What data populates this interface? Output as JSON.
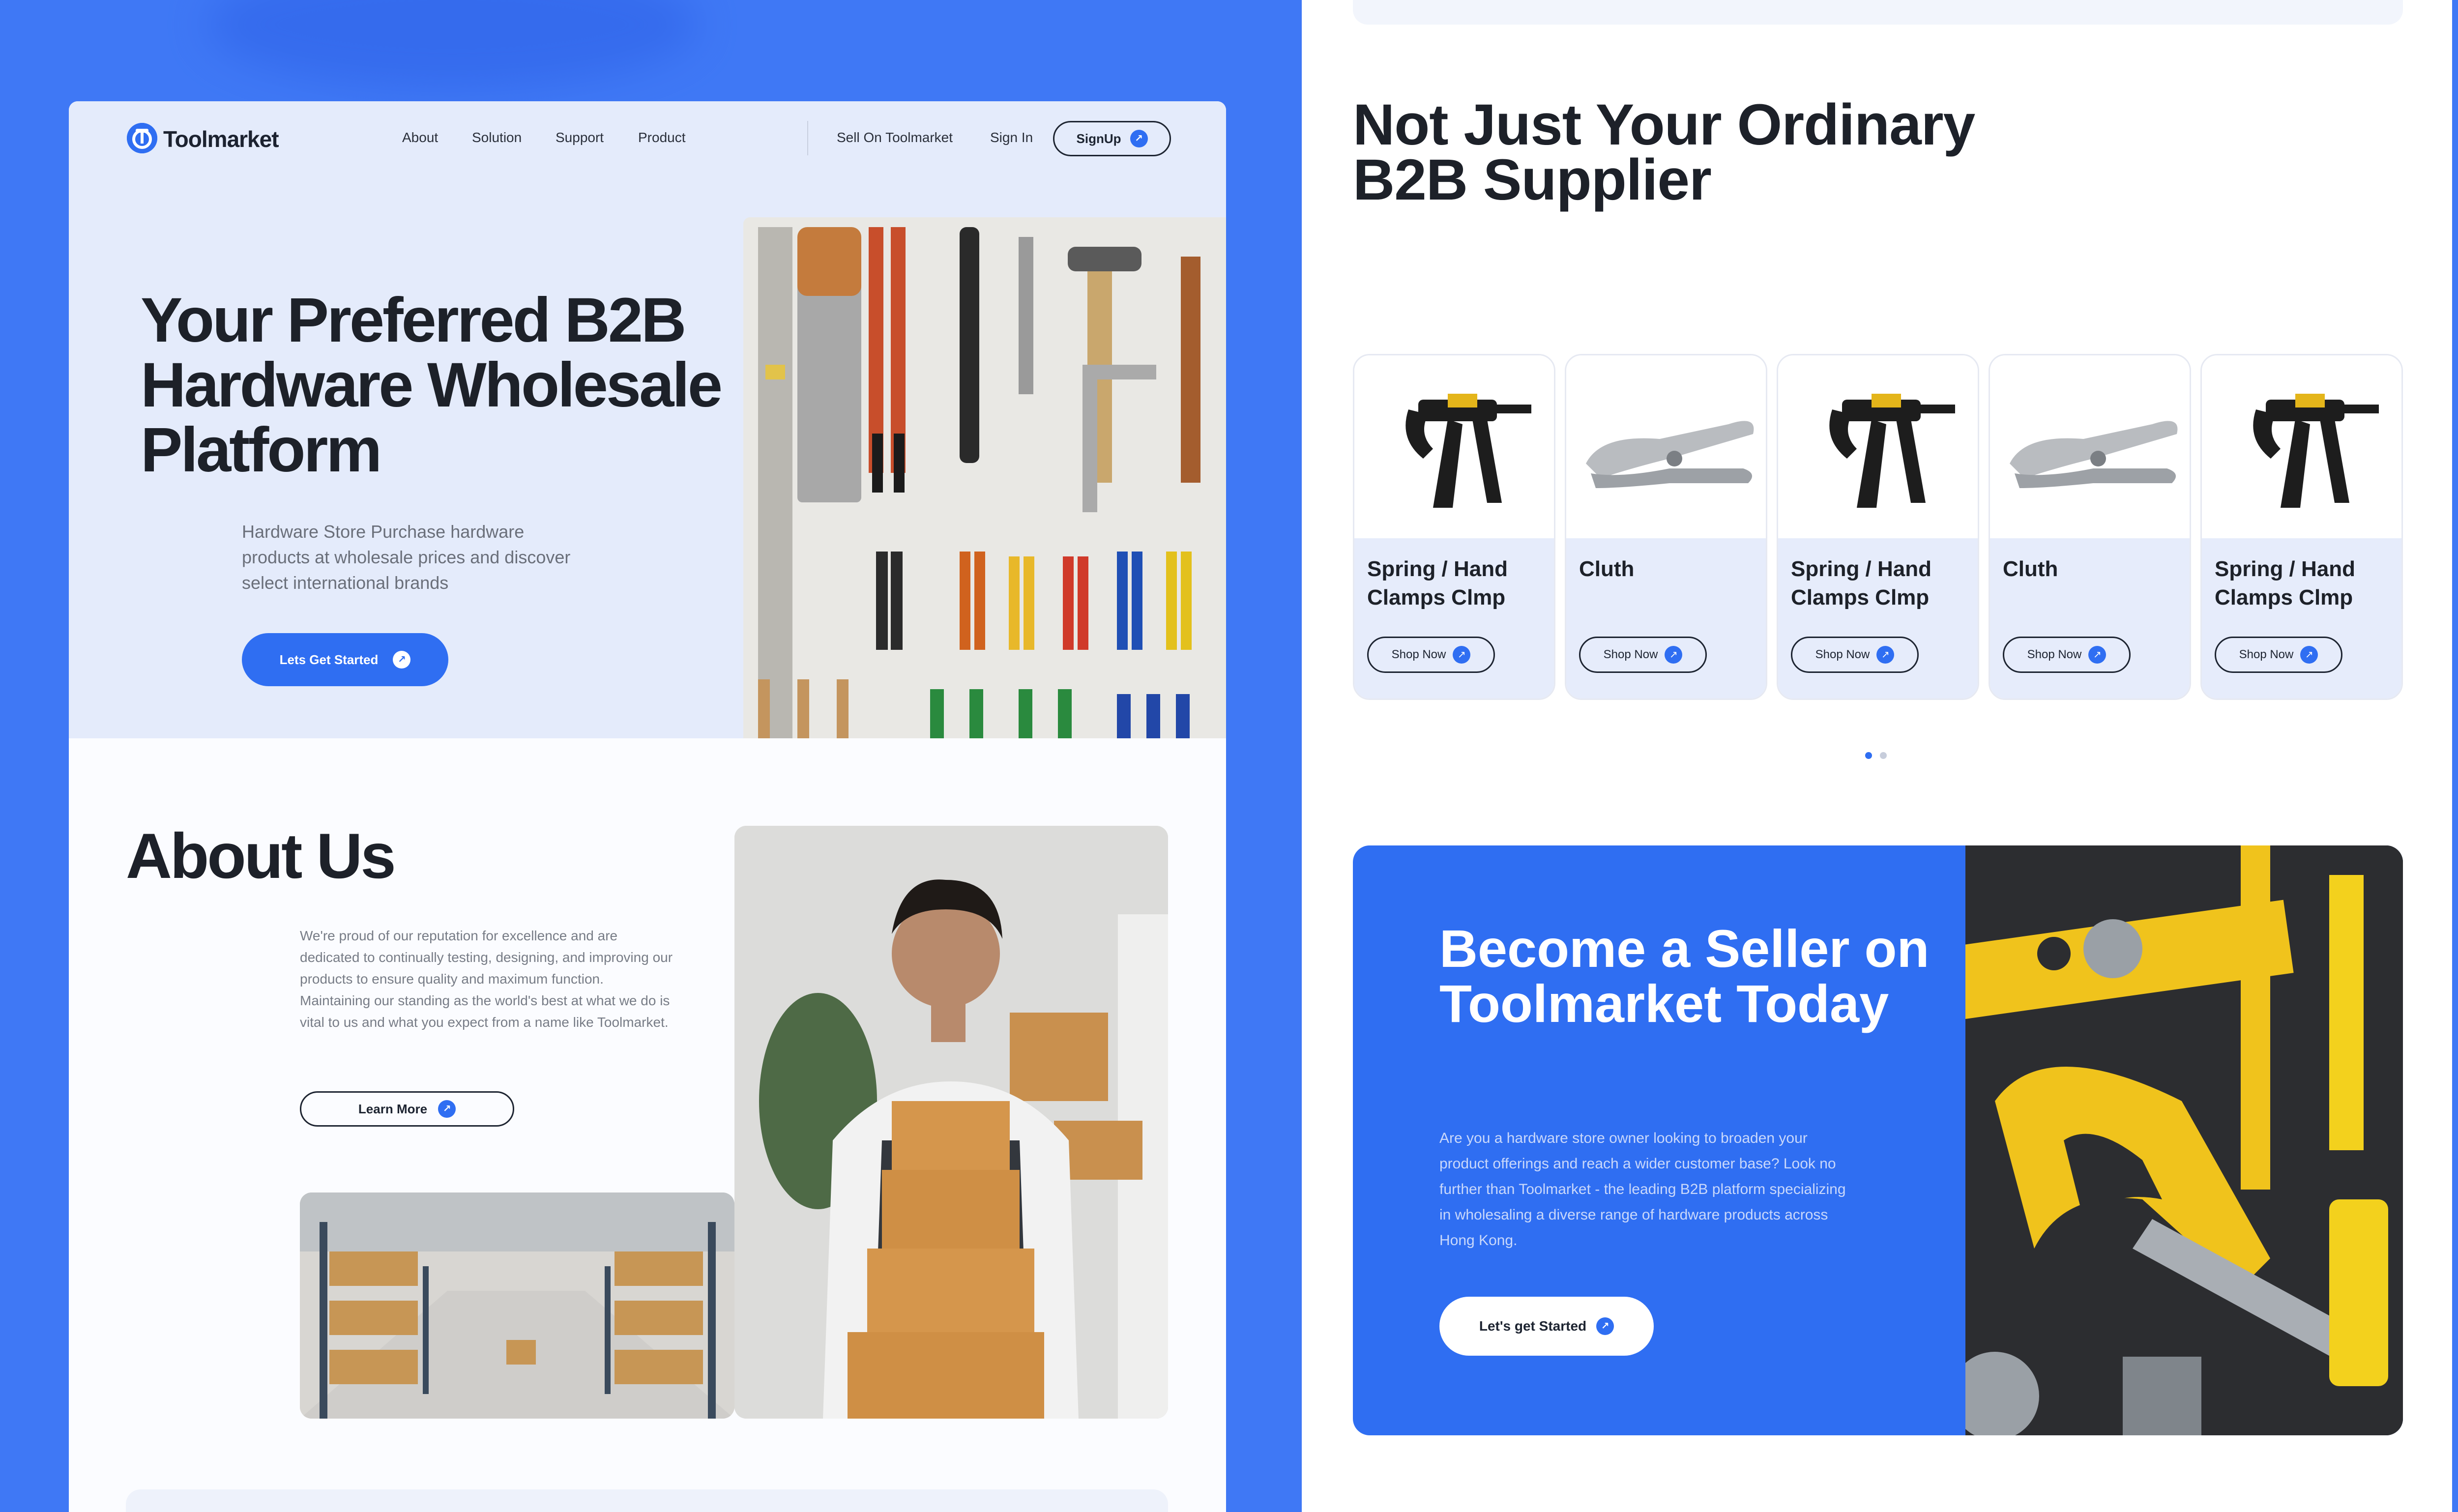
{
  "nav": {
    "brand": "Toolmarket",
    "links": [
      "About",
      "Solution",
      "Support",
      "Product"
    ],
    "sell": "Sell On Toolmarket",
    "signin": "Sign In",
    "signup": "SignUp"
  },
  "hero": {
    "title": "Your Preferred B2B Hardware Wholesale Platform",
    "subtitle": "Hardware Store Purchase hardware products at wholesale prices and discover select international brands",
    "cta": "Lets Get Started"
  },
  "about": {
    "title": "About Us",
    "text": "We're proud of our reputation for excellence and are dedicated to continually testing, designing, and improving our products to ensure quality and maximum function. Maintaining our standing as the world's best at what we do is vital to us and what you expect from a name like Toolmarket.",
    "cta": "Learn More"
  },
  "products": {
    "title": "Not Just Your Ordinary B2B Supplier",
    "shop_label": "Shop Now",
    "items": [
      {
        "name": "Spring / Hand Clamps Clmp",
        "icon": "clamp"
      },
      {
        "name": "Cluth",
        "icon": "pliers"
      },
      {
        "name": "Spring / Hand Clamps Clmp",
        "icon": "clamp"
      },
      {
        "name": "Cluth",
        "icon": "pliers"
      },
      {
        "name": "Spring / Hand Clamps Clmp",
        "icon": "clamp"
      }
    ],
    "pagination": {
      "pages": 2,
      "active": 1
    }
  },
  "seller": {
    "title": "Become a Seller on Toolmarket Today",
    "text": "Are you a hardware store owner looking to broaden your product offerings and reach a wider customer base? Look no further than Toolmarket - the leading B2B platform specializing in wholesaling a diverse range of hardware products across Hong Kong.",
    "cta": "Let's get Started"
  },
  "colors": {
    "accent": "#2f6ef2",
    "background": "#3f78f5",
    "hero_bg": "#e4ebfb",
    "dark": "#1d2129"
  }
}
